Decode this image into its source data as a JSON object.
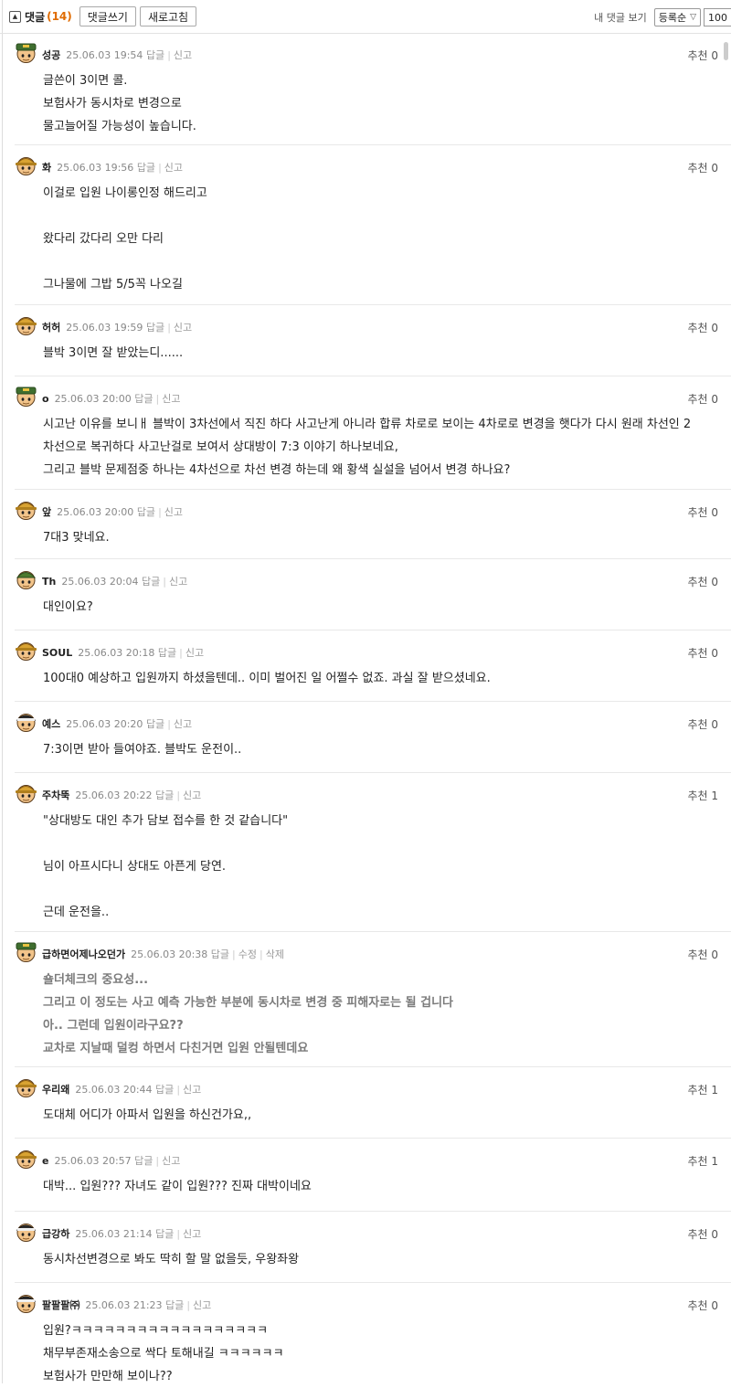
{
  "toolbar": {
    "comments_label": "댓글",
    "comments_count": "(14)",
    "write_button": "댓글쓰기",
    "refresh_button": "새로고침",
    "my_comments_label": "내 댓글 보기",
    "sort_select": "등록순",
    "page_size_select": "100"
  },
  "comments": [
    {
      "nick": "성공",
      "date": "25.06.03 19:54",
      "reply": "답글",
      "report": "신고",
      "recommend": "추천 0",
      "avatar": "soldier-avatar",
      "bold_body": false,
      "lines": [
        "글쓴이 3이면 콜.",
        "보험사가 동시차로 변경으로",
        "물고늘어질 가능성이 높습니다."
      ]
    },
    {
      "nick": "화",
      "date": "25.06.03 19:56",
      "reply": "답글",
      "report": "신고",
      "recommend": "추천 0",
      "avatar": "helmet-avatar",
      "bold_body": false,
      "lines": [
        "이걸로 입원 나이롱인정 해드리고",
        "",
        "왔다리 갔다리 오만 다리",
        "",
        "그나물에 그밥 5/5꼭 나오길"
      ]
    },
    {
      "nick": "허허",
      "date": "25.06.03 19:59",
      "reply": "답글",
      "report": "신고",
      "recommend": "추천 0",
      "avatar": "helmet-avatar",
      "bold_body": false,
      "lines": [
        "블박 3이면 잘 받았는디......"
      ]
    },
    {
      "nick": "o",
      "date": "25.06.03 20:00",
      "reply": "답글",
      "report": "신고",
      "recommend": "추천 0",
      "avatar": "soldier-avatar",
      "bold_body": false,
      "lines": [
        "시고난 이유를 보니ㅐ 블박이 3차선에서 직진 하다 사고난게 아니라 합류 차로로 보이는 4차로로 변경을 햇다가 다시 원래 차선인 2",
        "차선으로 복귀하다 사고난걸로 보여서 상대방이 7:3 이야기 하나보네요,",
        "그리고 블박 문제점중 하나는 4차선으로 차선 변경 하는데 왜 황색 실설을 넘어서 변경 하나요?"
      ]
    },
    {
      "nick": "앞",
      "date": "25.06.03 20:00",
      "reply": "답글",
      "report": "신고",
      "recommend": "추천 0",
      "avatar": "helmet-avatar",
      "bold_body": false,
      "lines": [
        "7대3 맞네요."
      ]
    },
    {
      "nick": "Th",
      "date": "25.06.03 20:04",
      "reply": "답글",
      "report": "신고",
      "recommend": "추천 0",
      "avatar": "green-avatar",
      "bold_body": false,
      "lines": [
        "대인이요?"
      ]
    },
    {
      "nick": "SOUL",
      "date": "25.06.03 20:18",
      "reply": "답글",
      "report": "신고",
      "recommend": "추천 0",
      "avatar": "helmet-avatar",
      "bold_body": false,
      "lines": [
        "100대0 예상하고 입원까지 하셨을텐데.. 이미 벌어진 일 어쩔수 없죠. 과실 잘 받으셨네요."
      ]
    },
    {
      "nick": "예스",
      "date": "25.06.03 20:20",
      "reply": "답글",
      "report": "신고",
      "recommend": "추천 0",
      "avatar": "bandana-avatar",
      "bold_body": false,
      "lines": [
        "7:3이면 받아 들여야죠. 블박도 운전이.."
      ]
    },
    {
      "nick": "주차뚝",
      "date": "25.06.03 20:22",
      "reply": "답글",
      "report": "신고",
      "recommend": "추천 1",
      "avatar": "helmet-avatar",
      "bold_body": false,
      "lines": [
        "\"상대방도 대인 추가 담보 접수를 한 것 같습니다\"",
        "",
        "님이 아프시다니 상대도 아픈게 당연.",
        "",
        "근데 운전을.."
      ]
    },
    {
      "nick": "급하면어제나오던가",
      "date": "25.06.03 20:38",
      "reply": "답글",
      "edit": "수정",
      "delete": "삭제",
      "recommend": "추천 0",
      "avatar": "soldier-avatar",
      "bold_body": true,
      "lines": [
        "숄더체크의 중요성...",
        "그리고 이 정도는 사고 예측 가능한 부분에 동시차로 변경 중 피해자로는 될 겁니다",
        "아.. 그런데 입원이라구요??",
        "교차로 지날때 덜컹 하면서 다친거면 입원 안될텐데요"
      ]
    },
    {
      "nick": "우리왜",
      "date": "25.06.03 20:44",
      "reply": "답글",
      "report": "신고",
      "recommend": "추천 1",
      "avatar": "helmet-avatar",
      "bold_body": false,
      "lines": [
        "도대체 어디가 아파서 입원을 하신건가요,,"
      ]
    },
    {
      "nick": "e",
      "date": "25.06.03 20:57",
      "reply": "답글",
      "report": "신고",
      "recommend": "추천 1",
      "avatar": "helmet-avatar",
      "bold_body": false,
      "lines": [
        "대박... 입원??? 자녀도 같이 입원??? 진짜 대박이네요"
      ]
    },
    {
      "nick": "급강하",
      "date": "25.06.03 21:14",
      "reply": "답글",
      "report": "신고",
      "recommend": "추천 0",
      "avatar": "bandana-avatar",
      "bold_body": false,
      "lines": [
        "동시차선변경으로 봐도 딱히 할 말 없을듯, 우왕좌왕"
      ]
    },
    {
      "nick": "팔팔팔㈜",
      "date": "25.06.03 21:23",
      "reply": "답글",
      "report": "신고",
      "recommend": "추천 0",
      "avatar": "bandana-avatar",
      "bold_body": false,
      "lines": [
        "입원?ㅋㅋㅋㅋㅋㅋㅋㅋㅋㅋㅋㅋㅋㅋㅋㅋㅋㅋ",
        "채무부존재소송으로 싹다 토해내길 ㅋㅋㅋㅋㅋㅋ",
        "보험사가 만만해 보이나??"
      ]
    }
  ]
}
